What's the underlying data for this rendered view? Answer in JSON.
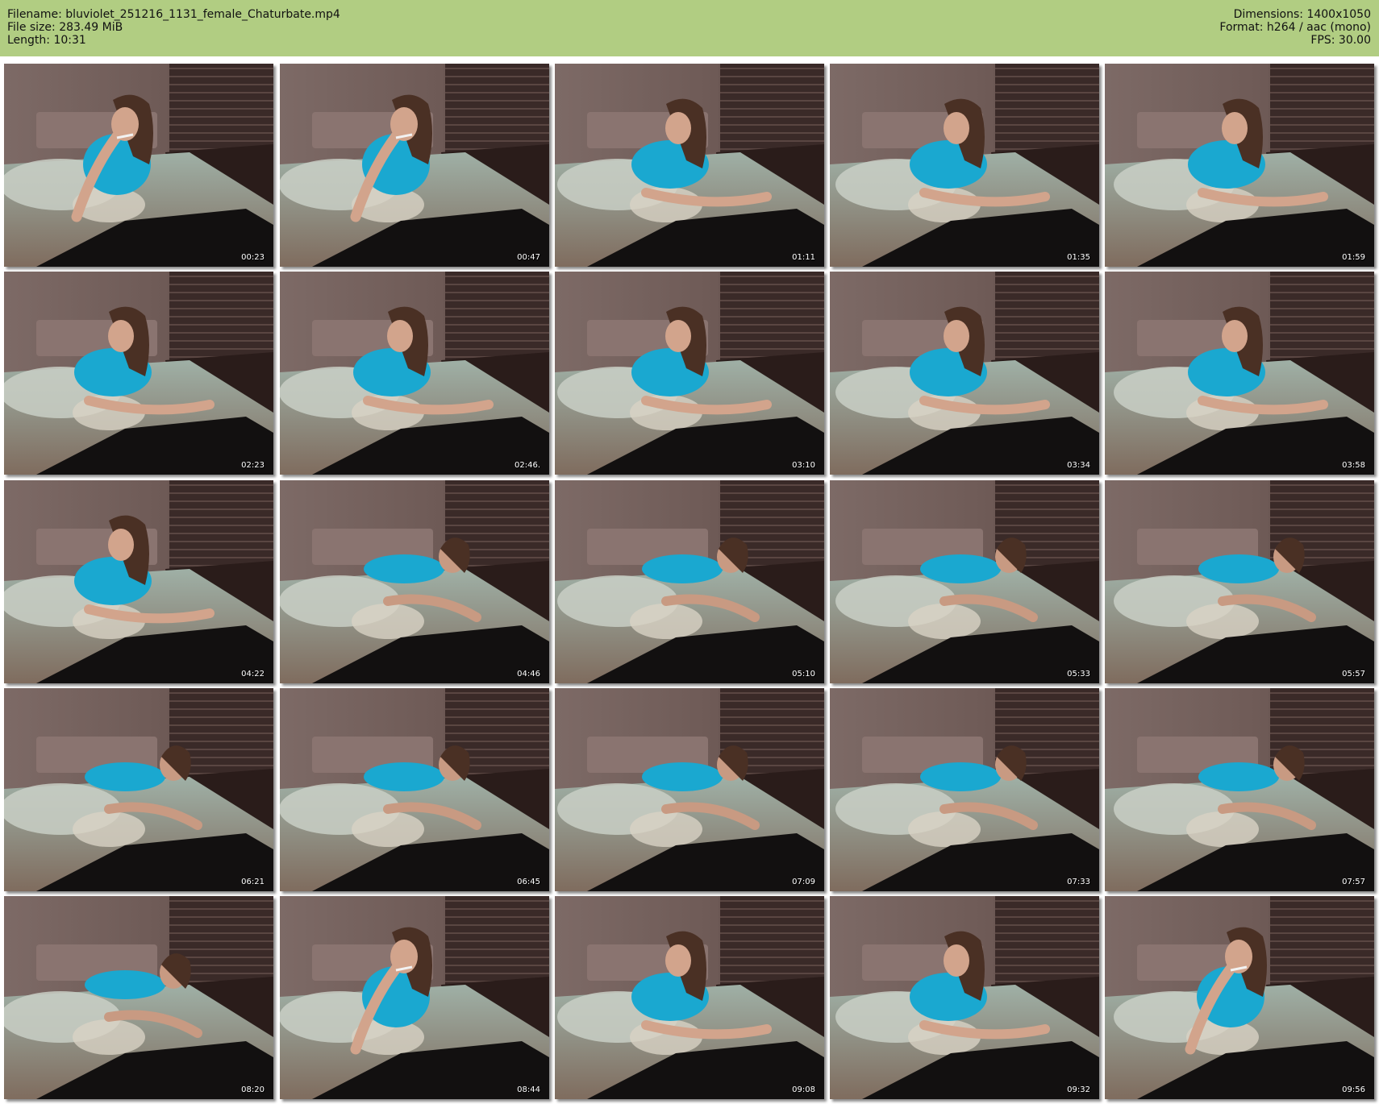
{
  "header": {
    "filename": "Filename: bluviolet_251216_1131_female_Chaturbate.mp4",
    "filesize": "File size: 283.49 MiB",
    "length": "Length: 10:31",
    "dimensions": "Dimensions: 1400x1050",
    "format": "Format: h264 / aac (mono)",
    "fps": "FPS: 30.00"
  },
  "colors": {
    "header_bg": "#b1cd82",
    "shirt": "#1aa8d0",
    "wall": "#6e5a56",
    "blinds": "#3a2a28"
  },
  "thumbnails": [
    {
      "timestamp": "00:23",
      "pose": "hand-at-mouth"
    },
    {
      "timestamp": "00:47",
      "pose": "hand-at-mouth"
    },
    {
      "timestamp": "01:11",
      "pose": "prone"
    },
    {
      "timestamp": "01:35",
      "pose": "prone"
    },
    {
      "timestamp": "01:59",
      "pose": "prone"
    },
    {
      "timestamp": "02:23",
      "pose": "prone"
    },
    {
      "timestamp": "02:46.",
      "pose": "prone"
    },
    {
      "timestamp": "03:10",
      "pose": "prone"
    },
    {
      "timestamp": "03:34",
      "pose": "prone"
    },
    {
      "timestamp": "03:58",
      "pose": "prone"
    },
    {
      "timestamp": "04:22",
      "pose": "prone"
    },
    {
      "timestamp": "04:46",
      "pose": "reclining"
    },
    {
      "timestamp": "05:10",
      "pose": "reclining"
    },
    {
      "timestamp": "05:33",
      "pose": "reclining"
    },
    {
      "timestamp": "05:57",
      "pose": "reclining"
    },
    {
      "timestamp": "06:21",
      "pose": "reclining"
    },
    {
      "timestamp": "06:45",
      "pose": "reclining"
    },
    {
      "timestamp": "07:09",
      "pose": "reclining"
    },
    {
      "timestamp": "07:33",
      "pose": "reclining"
    },
    {
      "timestamp": "07:57",
      "pose": "reclining"
    },
    {
      "timestamp": "08:20",
      "pose": "reclining"
    },
    {
      "timestamp": "08:44",
      "pose": "hand-at-mouth"
    },
    {
      "timestamp": "09:08",
      "pose": "prone"
    },
    {
      "timestamp": "09:32",
      "pose": "prone"
    },
    {
      "timestamp": "09:56",
      "pose": "hand-at-mouth"
    }
  ]
}
